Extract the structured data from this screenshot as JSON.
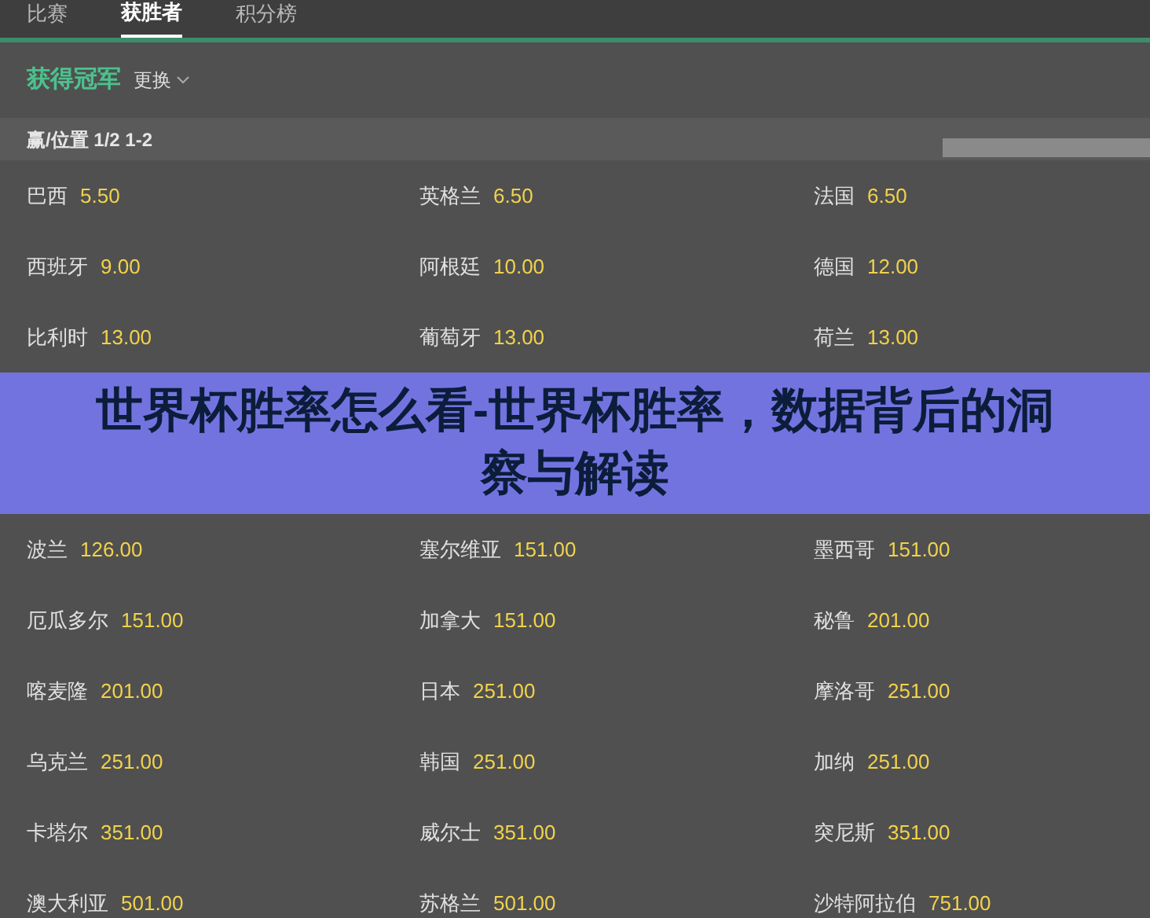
{
  "tabs": [
    {
      "label": "比赛",
      "selected": false
    },
    {
      "label": "获胜者",
      "selected": true
    },
    {
      "label": "积分榜",
      "selected": false
    }
  ],
  "market": {
    "title": "获得冠军",
    "switch_label": "更换"
  },
  "table_header": {
    "label": "赢/位置 1/2 1-2"
  },
  "rows": [
    [
      {
        "team": "巴西",
        "odds": "5.50"
      },
      {
        "team": "英格兰",
        "odds": "6.50"
      },
      {
        "team": "法国",
        "odds": "6.50"
      }
    ],
    [
      {
        "team": "西班牙",
        "odds": "9.00"
      },
      {
        "team": "阿根廷",
        "odds": "10.00"
      },
      {
        "team": "德国",
        "odds": "12.00"
      }
    ],
    [
      {
        "team": "比利时",
        "odds": "13.00"
      },
      {
        "team": "葡萄牙",
        "odds": "13.00"
      },
      {
        "team": "荷兰",
        "odds": "13.00"
      }
    ],
    [
      {
        "team": "波兰",
        "odds": "126.00"
      },
      {
        "team": "塞尔维亚",
        "odds": "151.00"
      },
      {
        "team": "墨西哥",
        "odds": "151.00"
      }
    ],
    [
      {
        "team": "厄瓜多尔",
        "odds": "151.00"
      },
      {
        "team": "加拿大",
        "odds": "151.00"
      },
      {
        "team": "秘鲁",
        "odds": "201.00"
      }
    ],
    [
      {
        "team": "喀麦隆",
        "odds": "201.00"
      },
      {
        "team": "日本",
        "odds": "251.00"
      },
      {
        "team": "摩洛哥",
        "odds": "251.00"
      }
    ],
    [
      {
        "team": "乌克兰",
        "odds": "251.00"
      },
      {
        "team": "韩国",
        "odds": "251.00"
      },
      {
        "team": "加纳",
        "odds": "251.00"
      }
    ],
    [
      {
        "team": "卡塔尔",
        "odds": "351.00"
      },
      {
        "team": "威尔士",
        "odds": "351.00"
      },
      {
        "team": "突尼斯",
        "odds": "351.00"
      }
    ],
    [
      {
        "team": "澳大利亚",
        "odds": "501.00"
      },
      {
        "team": "苏格兰",
        "odds": "501.00"
      },
      {
        "team": "沙特阿拉伯",
        "odds": "751.00"
      }
    ]
  ],
  "banner": {
    "title": "世界杯胜率怎么看-世界杯胜率，数据背后的洞察与解读"
  }
}
